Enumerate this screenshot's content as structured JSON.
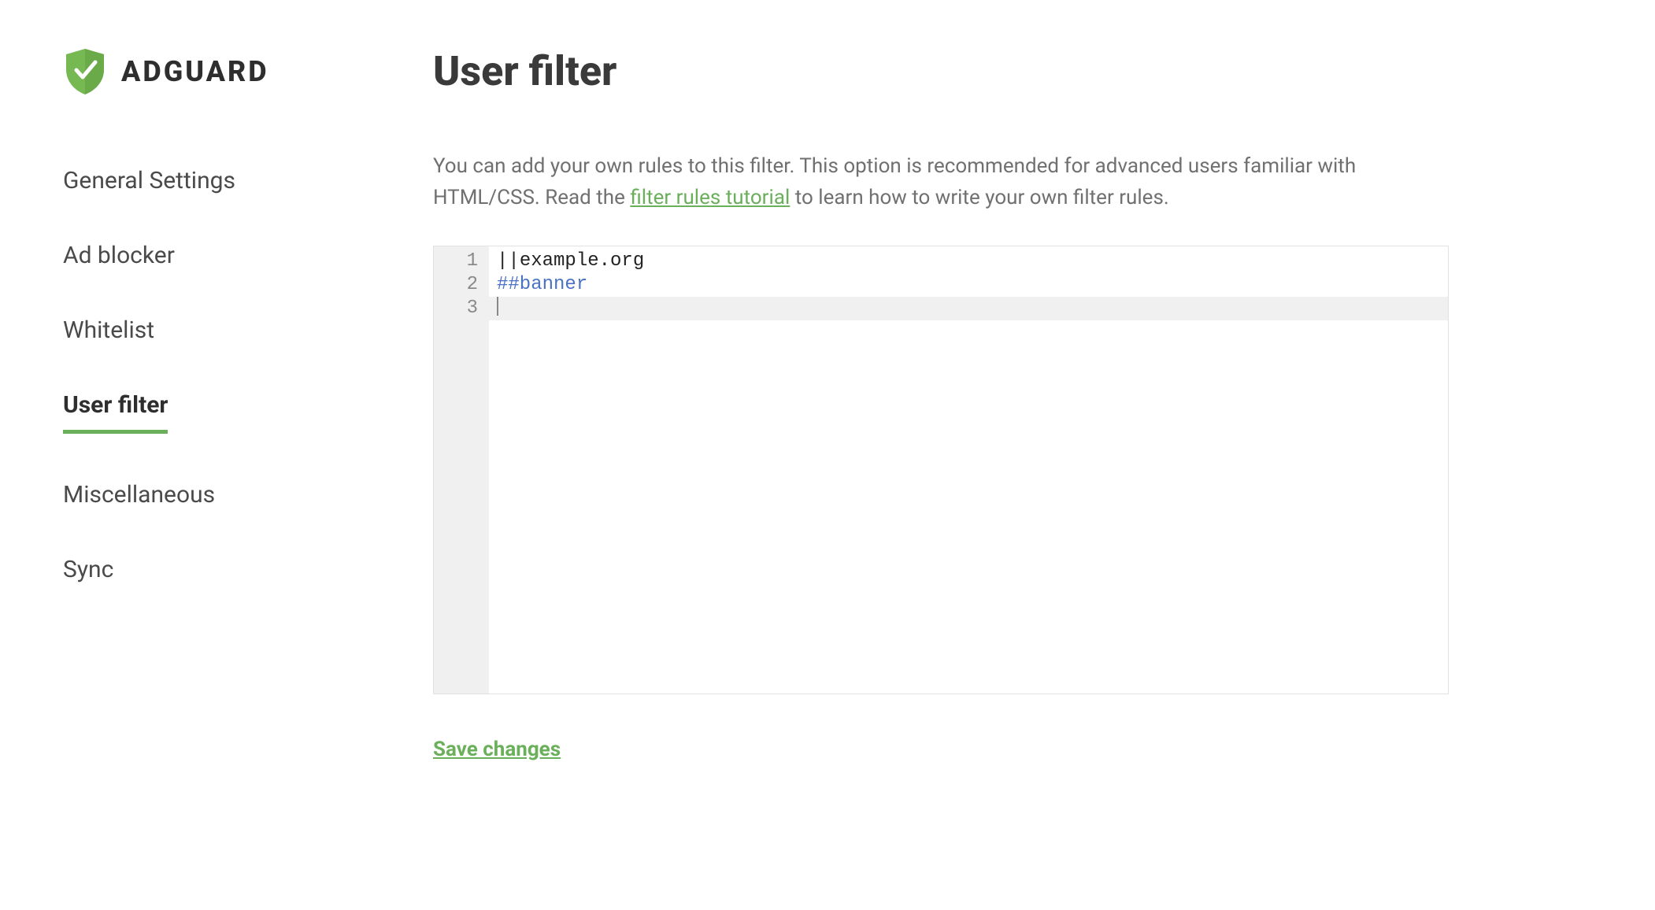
{
  "brand": {
    "name": "ADGUARD"
  },
  "sidebar": {
    "items": [
      {
        "label": "General Settings",
        "active": false
      },
      {
        "label": "Ad blocker",
        "active": false
      },
      {
        "label": "Whitelist",
        "active": false
      },
      {
        "label": "User filter",
        "active": true
      },
      {
        "label": "Miscellaneous",
        "active": false
      },
      {
        "label": "Sync",
        "active": false
      }
    ]
  },
  "main": {
    "title": "User filter",
    "description_pre": "You can add your own rules to this filter. This option is recommended for advanced users familiar with HTML/CSS. Read the ",
    "description_link": "filter rules tutorial",
    "description_post": " to learn how to write your own filter rules."
  },
  "editor": {
    "line_numbers": [
      "1",
      "2",
      "3"
    ],
    "lines": [
      {
        "op": "||",
        "host": "example.org"
      },
      {
        "rule": "##banner"
      },
      {
        "current": true
      }
    ]
  },
  "actions": {
    "save_label": "Save changes"
  }
}
